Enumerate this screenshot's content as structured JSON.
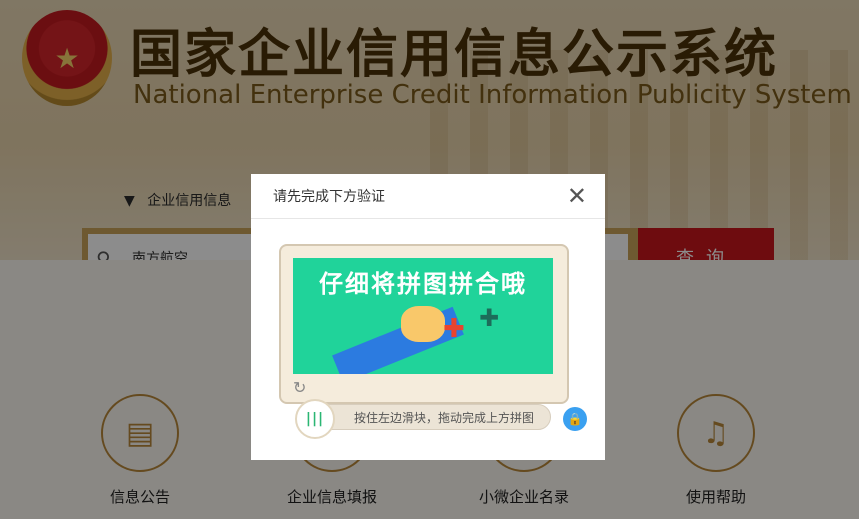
{
  "header": {
    "title_cn": "国家企业信用信息公示系统",
    "title_en": "National Enterprise Credit Information Publicity System",
    "emblem_icon": "national-emblem-icon"
  },
  "search": {
    "type_label": "企业信用信息",
    "query_value": "南方航空",
    "button_label": "查询",
    "icon": "search-icon"
  },
  "features": [
    {
      "label": "信息公告",
      "icon": "document-icon"
    },
    {
      "label": "企业信息填报",
      "icon": "form-icon"
    },
    {
      "label": "小微企业名录",
      "icon": "list-icon"
    },
    {
      "label": "使用帮助",
      "icon": "speaker-icon"
    }
  ],
  "modal": {
    "title": "请先完成下方验证",
    "close_icon": "close-icon",
    "captcha_banner": "仔细将拼图拼合哦",
    "slider_hint": "按住左边滑块，拖动完成上方拼图",
    "refresh_icon": "refresh-icon",
    "lock_icon": "lock-icon"
  },
  "colors": {
    "brand_red": "#c8161d",
    "gold": "#c9a25a",
    "captcha_green": "#20d39a"
  }
}
